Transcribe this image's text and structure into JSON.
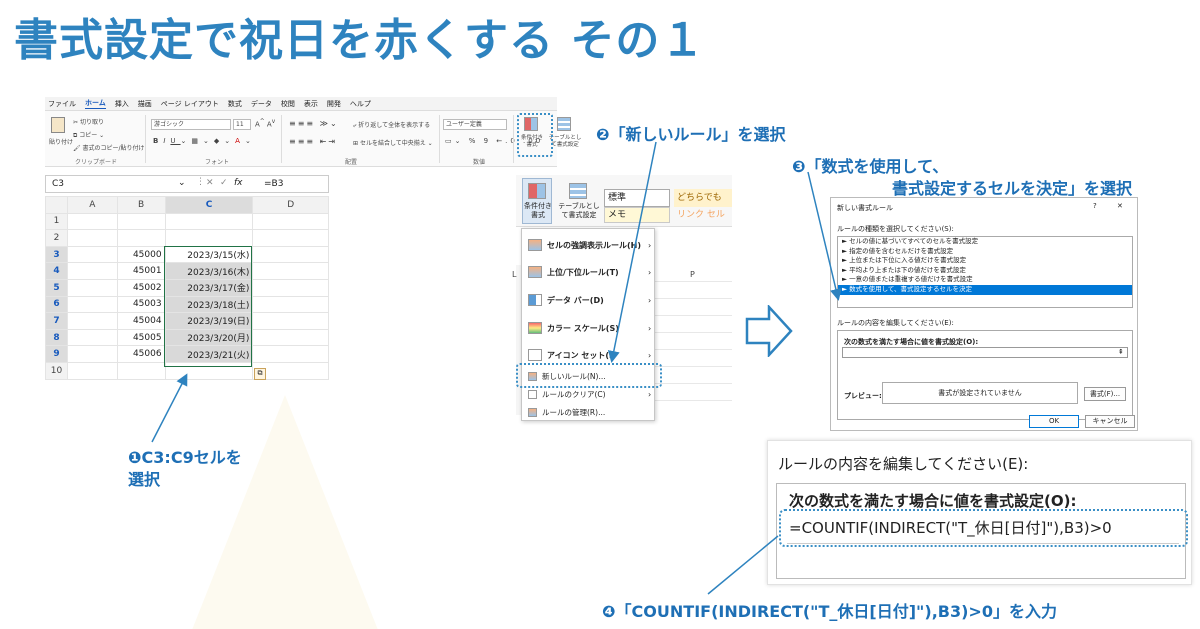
{
  "title": "書式設定で祝日を赤くする その１",
  "steps": {
    "s1_line1": "❶C3:C9セルを",
    "s1_line2": "選択",
    "s2": "❷「新しいルール」を選択",
    "s3_line1": "❸「数式を使用して、",
    "s3_line2": "書式設定するセルを決定」を選択",
    "s4": "❹「COUNTIF(INDIRECT(\"T_休日[日付]\"),B3)>0」を入力"
  },
  "ribbon": {
    "tabs": [
      "ファイル",
      "ホーム",
      "挿入",
      "描画",
      "ページ レイアウト",
      "数式",
      "データ",
      "校閲",
      "表示",
      "開発",
      "ヘルプ"
    ],
    "paste": "貼り付け",
    "cut": "切り取り",
    "copy": "コピー",
    "format_painter": "書式のコピー/貼り付け",
    "font_name": "游ゴシック",
    "font_size": "11",
    "wrap": "折り返して全体を表示する",
    "merge": "セルを結合して中央揃え",
    "number_format": "ユーザー定義",
    "cf_button": "条件付き書式",
    "table_button": "テーブルとして書式設定",
    "grp_clipboard": "クリップボード",
    "grp_font": "フォント",
    "grp_align": "配置",
    "grp_number": "数値"
  },
  "formula_bar": {
    "cell_ref": "C3",
    "fx": "fx",
    "formula": "=B3"
  },
  "grid": {
    "cols": [
      "A",
      "B",
      "C",
      "D"
    ],
    "rows": [
      {
        "n": "1",
        "b": "",
        "c": ""
      },
      {
        "n": "2",
        "b": "",
        "c": ""
      },
      {
        "n": "3",
        "b": "45000",
        "c": "2023/3/15(水)"
      },
      {
        "n": "4",
        "b": "45001",
        "c": "2023/3/16(木)"
      },
      {
        "n": "5",
        "b": "45002",
        "c": "2023/3/17(金)"
      },
      {
        "n": "6",
        "b": "45003",
        "c": "2023/3/18(土)"
      },
      {
        "n": "7",
        "b": "45004",
        "c": "2023/3/19(日)"
      },
      {
        "n": "8",
        "b": "45005",
        "c": "2023/3/20(月)"
      },
      {
        "n": "9",
        "b": "45006",
        "c": "2023/3/21(火)"
      },
      {
        "n": "10",
        "b": "",
        "c": ""
      }
    ]
  },
  "cf_menu": {
    "cf_label": "条件付き書式",
    "table_label": "テーブルとして書式設定",
    "style_standard": "標準",
    "style_dochira": "どちらでも",
    "style_memo": "メモ",
    "style_link": "リンク セル",
    "col_L": "L",
    "col_P": "P",
    "items": [
      "セルの強調表示ルール(H)",
      "上位/下位ルール(T)",
      "データ バー(D)",
      "カラー スケール(S)",
      "アイコン セット(I)",
      "新しいルール(N)...",
      "ルールのクリア(C)",
      "ルールの管理(R)..."
    ]
  },
  "dialog": {
    "title": "新しい書式ルール",
    "help": "?",
    "close": "✕",
    "rule_type_label": "ルールの種類を選択してください(S):",
    "rule_types": [
      "► セルの値に基づいてすべてのセルを書式設定",
      "► 指定の値を含むセルだけを書式設定",
      "► 上位または下位に入る値だけを書式設定",
      "► 平均より上または下の値だけを書式設定",
      "► 一意の値または重複する値だけを書式設定",
      "► 数式を使用して、書式設定するセルを決定"
    ],
    "edit_label": "ルールの内容を編集してください(E):",
    "formula_label": "次の数式を満たす場合に値を書式設定(O):",
    "preview_label": "プレビュー:",
    "preview_text": "書式が設定されていません",
    "format_btn": "書式(F)...",
    "ok": "OK",
    "cancel": "キャンセル"
  },
  "zoom": {
    "edit_label": "ルールの内容を編集してください(E):",
    "formula_label": "次の数式を満たす場合に値を書式設定(O):",
    "formula": "=COUNTIF(INDIRECT(\"T_休日[日付]\"),B3)>0"
  }
}
